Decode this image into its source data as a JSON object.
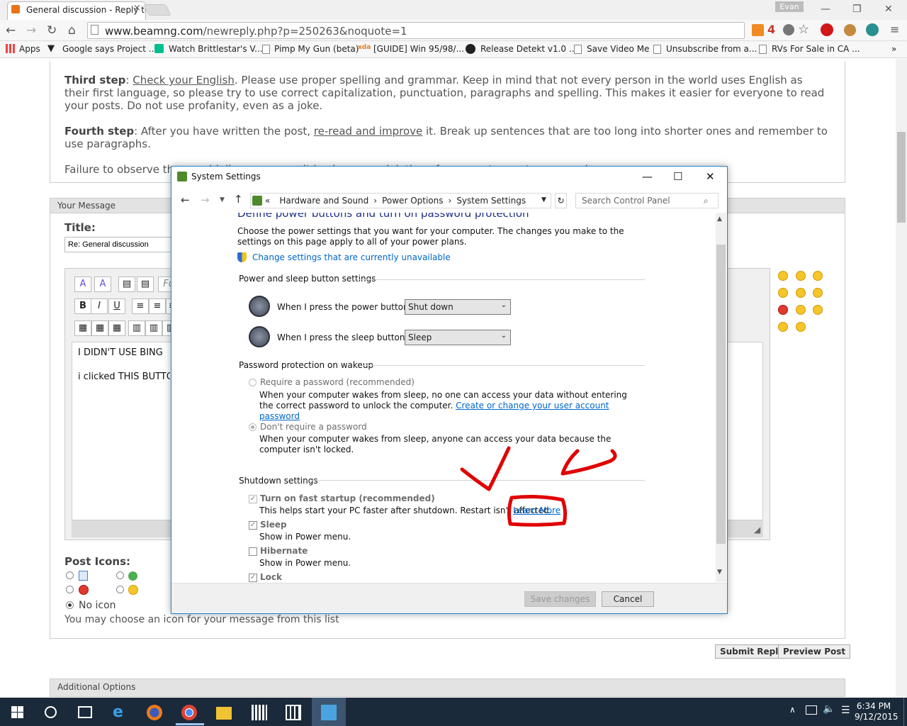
{
  "browser": {
    "tab_title": "General discussion - Reply to Topic",
    "profile": "Evan",
    "url_domain": "www.beamng.com",
    "url_path": "/newreply.php?p=250263&noquote=1",
    "badge": "4",
    "bookmarks": [
      "Apps",
      "Google says Project ...",
      "Watch Brittlestar's V...",
      "Pimp My Gun (beta)",
      "[GUIDE] Win 95/98/...",
      "Release Detekt v1.0 ...",
      "Save Video Me",
      "Unsubscribe from a...",
      "RVs For Sale in CA ..."
    ],
    "more": "»"
  },
  "page": {
    "third_step_label": "Third step",
    "third_step_link": "Check your English",
    "third_step_text": ". Please use proper spelling and grammar. Keep in mind that not every person in the world uses English as their first language, so please try to use correct capitalization, punctuation, paragraphs and spelling. This makes it easier for everyone to read your posts. Do not use profanity, even as a joke.",
    "fourth_step_label": "Fourth step",
    "fourth_step_text1": ": After you have written the post, ",
    "fourth_step_link": "re-read and improve",
    "fourth_step_text2": " it. Break up sentences that are too long into shorter ones and remember to use paragraphs.",
    "failure_text": "Failure to observe these guidelines may result in closure or deletion of your posts or a temporary ban.",
    "your_message": "Your Message",
    "title_label": "Title:",
    "title_value": "Re: General discussion",
    "font_placeholder": "Fo",
    "message_line1": "I DIDN'T USE BING",
    "message_line2": "i clicked THIS BUTTON",
    "post_icons": "Post Icons:",
    "no_icon": "No icon",
    "icon_hint": "You may choose an icon for your message from this list",
    "submit": "Submit Reply",
    "preview": "Preview Post",
    "additional": "Additional Options"
  },
  "dialog": {
    "title": "System Settings",
    "crumbs": [
      "Hardware and Sound",
      "Power Options",
      "System Settings"
    ],
    "crumb_prefix": "«",
    "search_placeholder": "Search Control Panel",
    "heading": "Define power buttons and turn on password protection",
    "intro": "Choose the power settings that you want for your computer. The changes you make to the settings on this page apply to all of your power plans.",
    "change_link": "Change settings that are currently unavailable",
    "power_group": "Power and sleep button settings",
    "power_label": "When I press the power button:",
    "power_value": "Shut down",
    "sleep_label": "When I press the sleep button:",
    "sleep_value": "Sleep",
    "pw_group": "Password protection on wakeup",
    "req_label": "Require a password (recommended)",
    "req_desc": "When your computer wakes from sleep, no one can access your data without entering the correct password to unlock the computer.",
    "req_link": "Create or change your user account password",
    "noreq_label": "Don't require a password",
    "noreq_desc": "When your computer wakes from sleep, anyone can access your data because the computer isn't locked.",
    "shutdown_group": "Shutdown settings",
    "fast_label": "Turn on fast startup (recommended)",
    "fast_desc": "This helps start your PC faster after shutdown. Restart isn't affected.",
    "learn_more": "Learn More",
    "sleep_opt": "Sleep",
    "sleep_opt_desc": "Show in Power menu.",
    "hib_opt": "Hibernate",
    "hib_opt_desc": "Show in Power menu.",
    "lock_opt": "Lock",
    "save": "Save changes",
    "cancel": "Cancel"
  },
  "taskbar": {
    "time": "6:34 PM",
    "date": "9/12/2015"
  },
  "colors": {
    "annotation": "#e00000",
    "accent": "#1c83d5",
    "taskbar": "#1b2a3a"
  }
}
